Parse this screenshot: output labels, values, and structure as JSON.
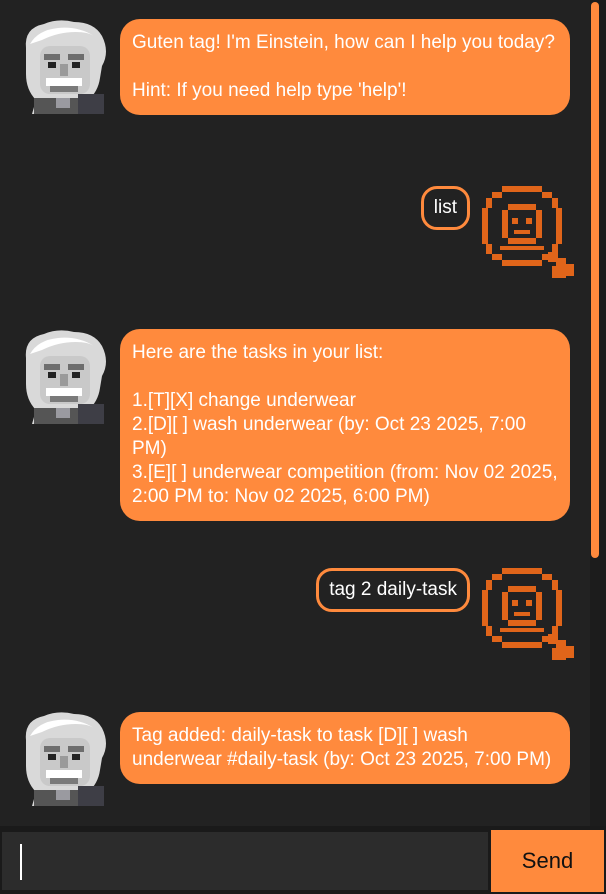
{
  "colors": {
    "accent": "#ff8a3d",
    "background": "#222222",
    "input_background": "#2c2c2c",
    "text": "#ffffff"
  },
  "messages": [
    {
      "sender": "bot",
      "avatar": "einstein-avatar-icon",
      "text": "Guten tag! I'm Einstein, how can I help you today?\n\nHint: If you need help type 'help'!"
    },
    {
      "sender": "user",
      "avatar": "user-magnifier-icon",
      "text": "list"
    },
    {
      "sender": "bot",
      "avatar": "einstein-avatar-icon",
      "text": "Here are the tasks in your list:\n\n1.[T][X] change underwear\n2.[D][ ] wash underwear (by: Oct 23 2025, 7:00 PM)\n3.[E][ ] underwear competition (from: Nov 02 2025, 2:00 PM to: Nov 02 2025, 6:00 PM)"
    },
    {
      "sender": "user",
      "avatar": "user-magnifier-icon",
      "text": "tag 2 daily-task"
    },
    {
      "sender": "bot",
      "avatar": "einstein-avatar-icon",
      "text": "Tag added: daily-task to task [D][ ] wash underwear #daily-task (by: Oct 23 2025, 7:00 PM)"
    }
  ],
  "input": {
    "value": "",
    "placeholder": ""
  },
  "send_label": "Send"
}
